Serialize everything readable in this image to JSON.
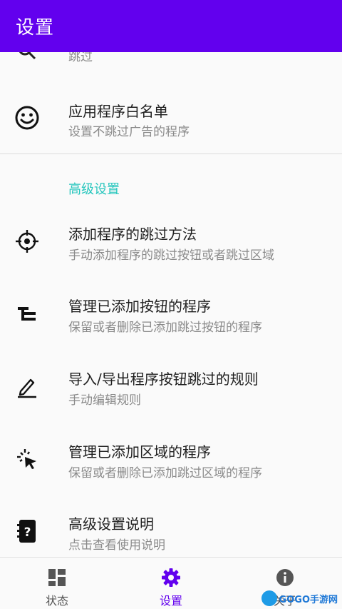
{
  "appbar": {
    "title": "设置"
  },
  "list": {
    "partial_item": {
      "sub": "跳过"
    },
    "whitelist": {
      "title": "应用程序白名单",
      "sub": "设置不跳过广告的程序"
    },
    "section_header": "高级设置",
    "add_method": {
      "title": "添加程序的跳过方法",
      "sub": "手动添加程序的跳过按钮或者跳过区域"
    },
    "manage_buttons": {
      "title": "管理已添加按钮的程序",
      "sub": "保留或者删除已添加跳过按钮的程序"
    },
    "import_export": {
      "title": "导入/导出程序按钮跳过的规则",
      "sub": "手动编辑规则"
    },
    "manage_regions": {
      "title": "管理已添加区域的程序",
      "sub": "保留或者删除已添加跳过区域的程序"
    },
    "help": {
      "title": "高级设置说明",
      "sub": "点击查看使用说明"
    }
  },
  "bottom_nav": {
    "items": [
      {
        "label": "状态",
        "icon": "dashboard-icon"
      },
      {
        "label": "设置",
        "icon": "gear-icon",
        "active": true
      },
      {
        "label": "关于",
        "icon": "info-icon"
      }
    ]
  },
  "watermark": {
    "text": "GOGO手游网"
  },
  "colors": {
    "primary": "#6200ee",
    "accent": "#26c6bd"
  }
}
